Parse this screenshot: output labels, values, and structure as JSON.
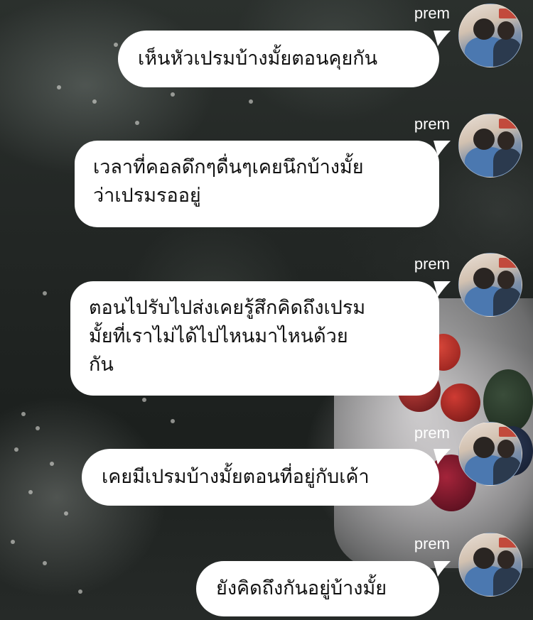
{
  "chat": {
    "sender": "prem",
    "messages": [
      {
        "author": "prem",
        "text": "เห็นหัวเปรมบ้างมั้ยตอนคุยกัน"
      },
      {
        "author": "prem",
        "text": "เวลาที่คอลดึกๆดื่นๆเคยนึกบ้างมั้ย\nว่าเปรมรออยู่"
      },
      {
        "author": "prem",
        "text": "ตอนไปรับไปส่งเคยรู้สึกคิดถึงเปรม\nมั้ยที่เราไม่ได้ไปไหนมาไหนด้วย\nกัน"
      },
      {
        "author": "prem",
        "text": "เคยมีเปรมบ้างมั้ยตอนที่อยู่กับเค้า"
      },
      {
        "author": "prem",
        "text": "ยังคิดถึงกันอยู่บ้างมั้ย"
      }
    ]
  },
  "colors": {
    "bubble": "#ffffff",
    "text": "#111111",
    "name": "#ffffff"
  },
  "icons": {
    "avatar": "avatar-photo-icon"
  }
}
